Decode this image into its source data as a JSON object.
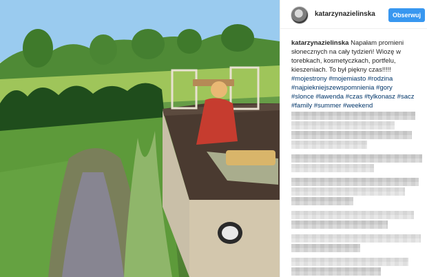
{
  "post": {
    "username": "katarzynazielinska",
    "follow_label": "Obserwuj",
    "caption": {
      "author": "katarzynazielinska",
      "text": "Napałam promieni słonecznych na cały tydzień! Wiozę w torebkach, kosmetyczkach, portfelu, kieszeniach. To był piękny czas!!!!!",
      "hashtags_line1": "#mojestrony #mojemiasto #rodzina",
      "hashtags_line2": "#najpiekniejszewspomnienia #gory",
      "hashtags_line3": "#slonce #lawenda #czas #tylkonasz #sacz",
      "hashtags_line4": "#family #summer #weekend"
    }
  },
  "colors": {
    "accent": "#3897f0",
    "hashtag": "#003569",
    "text": "#262626"
  },
  "icons": {
    "avatar": "profile-avatar"
  }
}
